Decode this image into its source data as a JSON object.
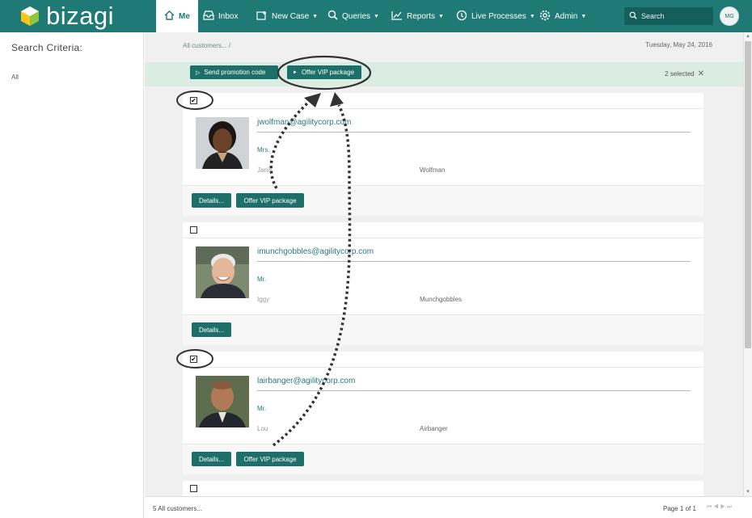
{
  "app": {
    "brand": "bizagi",
    "accent": "#1f7a76"
  },
  "nav": {
    "me": "Me",
    "inbox": "Inbox",
    "new_case": "New Case",
    "queries": "Queries",
    "reports": "Reports",
    "live_processes": "Live Processes",
    "admin": "Admin"
  },
  "search": {
    "placeholder": "Search"
  },
  "user": {
    "initials": "MG"
  },
  "sidebar": {
    "title": "Search Criteria:",
    "filter": "All"
  },
  "main": {
    "breadcrumb": "All customers... /",
    "date": "Tuesday, May 24, 2016",
    "actions": {
      "send_promo": "Send promotion code",
      "offer_vip": "Offer VIP package"
    },
    "selected": "2 selected"
  },
  "customers": [
    {
      "checked": "✔",
      "email": "jwolfman@agilitycorp.com",
      "title": "Mrs.",
      "first_name": "Janis",
      "last_name": "Wolfman",
      "details": "Details...",
      "vip": "Offer VIP package"
    },
    {
      "checked": "",
      "email": "imunchgobbles@agilitycorp.com",
      "title": "Mr.",
      "first_name": "Iggy",
      "last_name": "Munchgobbles",
      "details": "Details..."
    },
    {
      "checked": "✔",
      "email": "lairbanger@agilitycorp.com",
      "title": "Mr.",
      "first_name": "Lou",
      "last_name": "Airbanger",
      "details": "Details...",
      "vip": "Offer VIP package"
    },
    {
      "checked": ""
    }
  ],
  "footer": {
    "count": "5 All customers...",
    "page": "Page 1 of 1"
  }
}
